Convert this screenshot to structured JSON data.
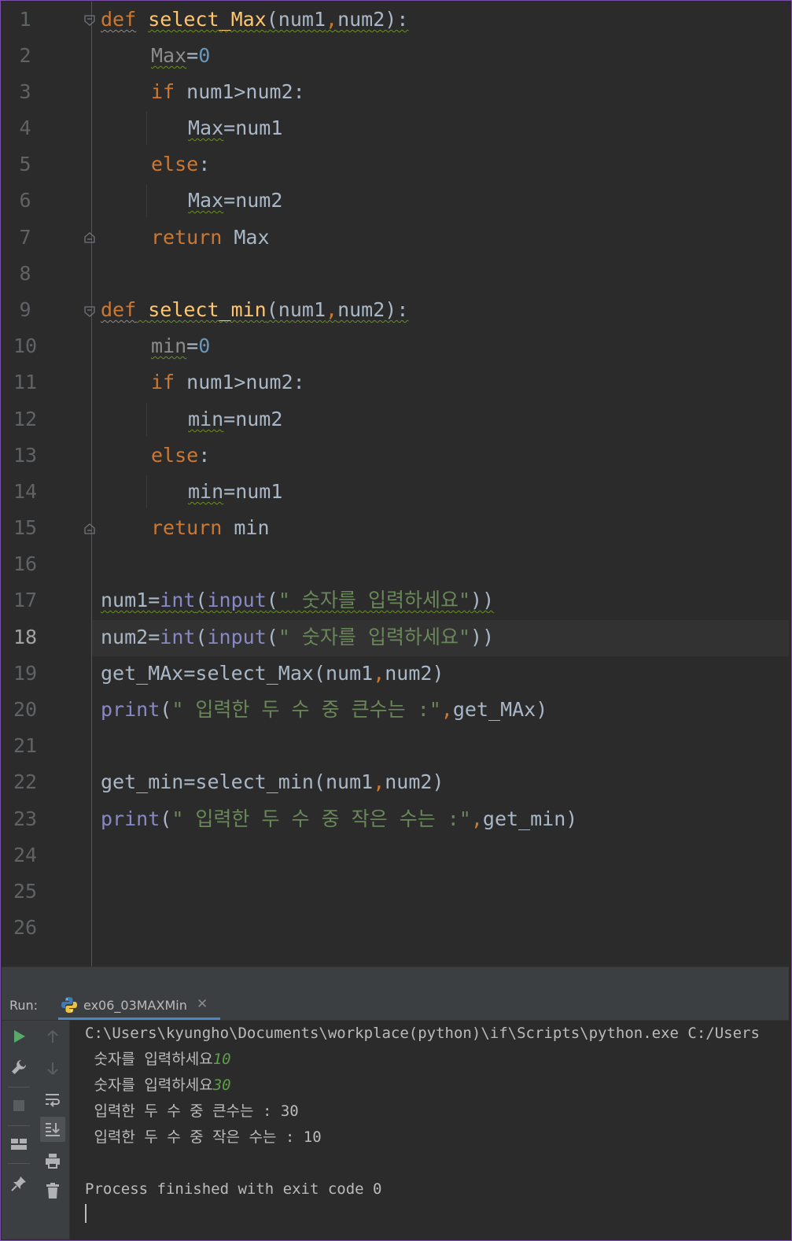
{
  "editor": {
    "line_numbers": [
      "1",
      "2",
      "3",
      "4",
      "5",
      "6",
      "7",
      "8",
      "9",
      "10",
      "11",
      "12",
      "13",
      "14",
      "15",
      "16",
      "17",
      "18",
      "19",
      "20",
      "21",
      "22",
      "23",
      "24",
      "25",
      "26"
    ],
    "current_line": "18",
    "code": {
      "l1": {
        "kw": "def",
        "fn": "select_Max",
        "rest": "(num1",
        "comma": ",",
        "rest2": "num2):"
      },
      "l2": {
        "var": "Max",
        "eq": "=",
        "num": "0"
      },
      "l3": {
        "kw": "if",
        "rest": " num1>num2:"
      },
      "l4": {
        "var": "Max",
        "rest": "=num1"
      },
      "l5": {
        "kw": "else",
        "rest": ":"
      },
      "l6": {
        "var": "Max",
        "rest": "=num2"
      },
      "l7": {
        "kw": "return",
        "rest": " Max"
      },
      "l9": {
        "kw": "def",
        "fn": "select_min",
        "rest": "(num1",
        "comma": ",",
        "rest2": "num2):"
      },
      "l10": {
        "var": "min",
        "eq": "=",
        "num": "0"
      },
      "l11": {
        "kw": "if",
        "rest": " num1>num2:"
      },
      "l12": {
        "var": "min",
        "rest": "=num2"
      },
      "l13": {
        "kw": "else",
        "rest": ":"
      },
      "l14": {
        "var": "min",
        "rest": "=num1"
      },
      "l15": {
        "kw": "return",
        "rest": " min"
      },
      "l17": {
        "a": "num1=",
        "bi1": "int",
        "p1": "(",
        "bi2": "input",
        "p2": "(",
        "str": "\" 숫자를 입력하세요\"",
        "end": "))"
      },
      "l18": {
        "a": "num2=",
        "bi1": "int",
        "p1": "(",
        "bi2": "input",
        "p2": "(",
        "str": "\" 숫자를 입력하세요\"",
        "end": "))"
      },
      "l19": {
        "a": "get_MAx=select_Max(num1",
        "comma": ",",
        "end": "num2)"
      },
      "l20": {
        "bi": "print",
        "p": "(",
        "str": "\" 입력한 두 수 중 큰수는 :\"",
        "comma": ",",
        "end": "get_MAx)"
      },
      "l22": {
        "a": "get_min=select_min(num1",
        "comma": ",",
        "end": "num2)"
      },
      "l23": {
        "bi": "print",
        "p": "(",
        "str": "\" 입력한 두 수 중 작은 수는 :\"",
        "comma": ",",
        "end": "get_min)"
      }
    }
  },
  "run_panel": {
    "label": "Run:",
    "tab_name": "ex06_03MAXMin",
    "tab_close": "✕",
    "console": {
      "command": "C:\\Users\\kyungho\\Documents\\workplace(python)\\if\\Scripts\\python.exe C:/Users",
      "prompt1": " 숫자를 입력하세요",
      "input1": "10",
      "prompt2": " 숫자를 입력하세요",
      "input2": "30",
      "out1": " 입력한 두 수 중 큰수는 : 30",
      "out2": " 입력한 두 수 중 작은 수는 : 10",
      "exit": "Process finished with exit code 0"
    }
  },
  "colors": {
    "keyword": "#cc7832",
    "function": "#ffc66d",
    "builtin": "#8888c6",
    "number": "#6897bb",
    "string": "#6a8759",
    "default": "#a9b7c6",
    "run_green": "#59a869",
    "user_input": "#5f9c4c"
  },
  "icons": {
    "run": "run-icon",
    "wrench": "wrench-icon",
    "stop": "stop-icon",
    "layout": "layout-icon",
    "pin": "pin-icon",
    "up": "arrow-up-icon",
    "down": "arrow-down-icon",
    "wrap": "soft-wrap-icon",
    "scroll": "scroll-to-end-icon",
    "print": "print-icon",
    "trash": "trash-icon",
    "python": "python-icon"
  }
}
